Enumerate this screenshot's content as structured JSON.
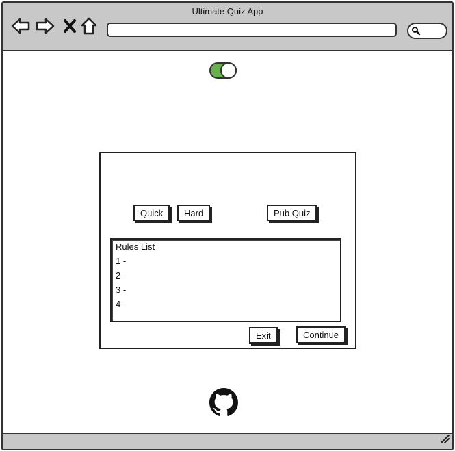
{
  "window": {
    "title": "Ultimate Quiz App"
  },
  "toolbar": {
    "back_icon": "back-arrow-icon",
    "forward_icon": "forward-arrow-icon",
    "stop_icon": "close-icon",
    "home_icon": "home-icon",
    "address_value": "",
    "search_icon": "search-icon"
  },
  "theme_toggle": {
    "state": "on",
    "color": "#6ab04c"
  },
  "quiz_panel": {
    "modes": [
      "Quick",
      "Hard",
      "Pub Quiz"
    ],
    "rules": {
      "heading": "Rules List",
      "items": [
        "1 -",
        "2 -",
        "3 -",
        "4 -"
      ]
    },
    "exit_label": "Exit",
    "continue_label": "Continue"
  },
  "footer": {
    "github_icon": "github-icon",
    "resize_icon": "resize-grip-icon"
  }
}
